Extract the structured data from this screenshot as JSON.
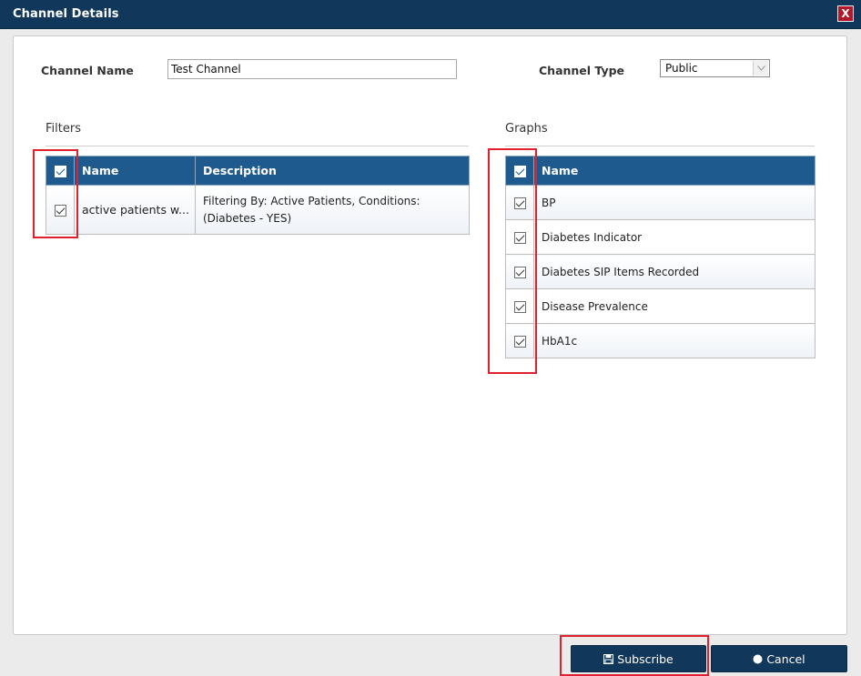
{
  "dialog": {
    "title": "Channel Details",
    "close_label": "X"
  },
  "form": {
    "channel_name_label": "Channel Name",
    "channel_name_value": "Test Channel",
    "channel_type_label": "Channel Type",
    "channel_type_value": "Public"
  },
  "filters": {
    "title": "Filters",
    "columns": [
      "Name",
      "Description"
    ],
    "rows": [
      {
        "checked": true,
        "name": "active patients w...",
        "description_line1": "Filtering By: Active Patients, Conditions:",
        "description_line2": "(Diabetes - YES)"
      }
    ]
  },
  "graphs": {
    "title": "Graphs",
    "columns": [
      "Name"
    ],
    "rows": [
      {
        "checked": true,
        "name": "BP"
      },
      {
        "checked": true,
        "name": "Diabetes Indicator"
      },
      {
        "checked": true,
        "name": "Diabetes SIP Items Recorded"
      },
      {
        "checked": true,
        "name": "Disease Prevalence"
      },
      {
        "checked": true,
        "name": "HbA1c"
      }
    ]
  },
  "buttons": {
    "subscribe_label": "Subscribe",
    "cancel_label": "Cancel"
  },
  "colors": {
    "titlebar": "#11375a",
    "header": "#1f5a8e",
    "highlight": "#e0202c",
    "close": "#b3172a"
  }
}
